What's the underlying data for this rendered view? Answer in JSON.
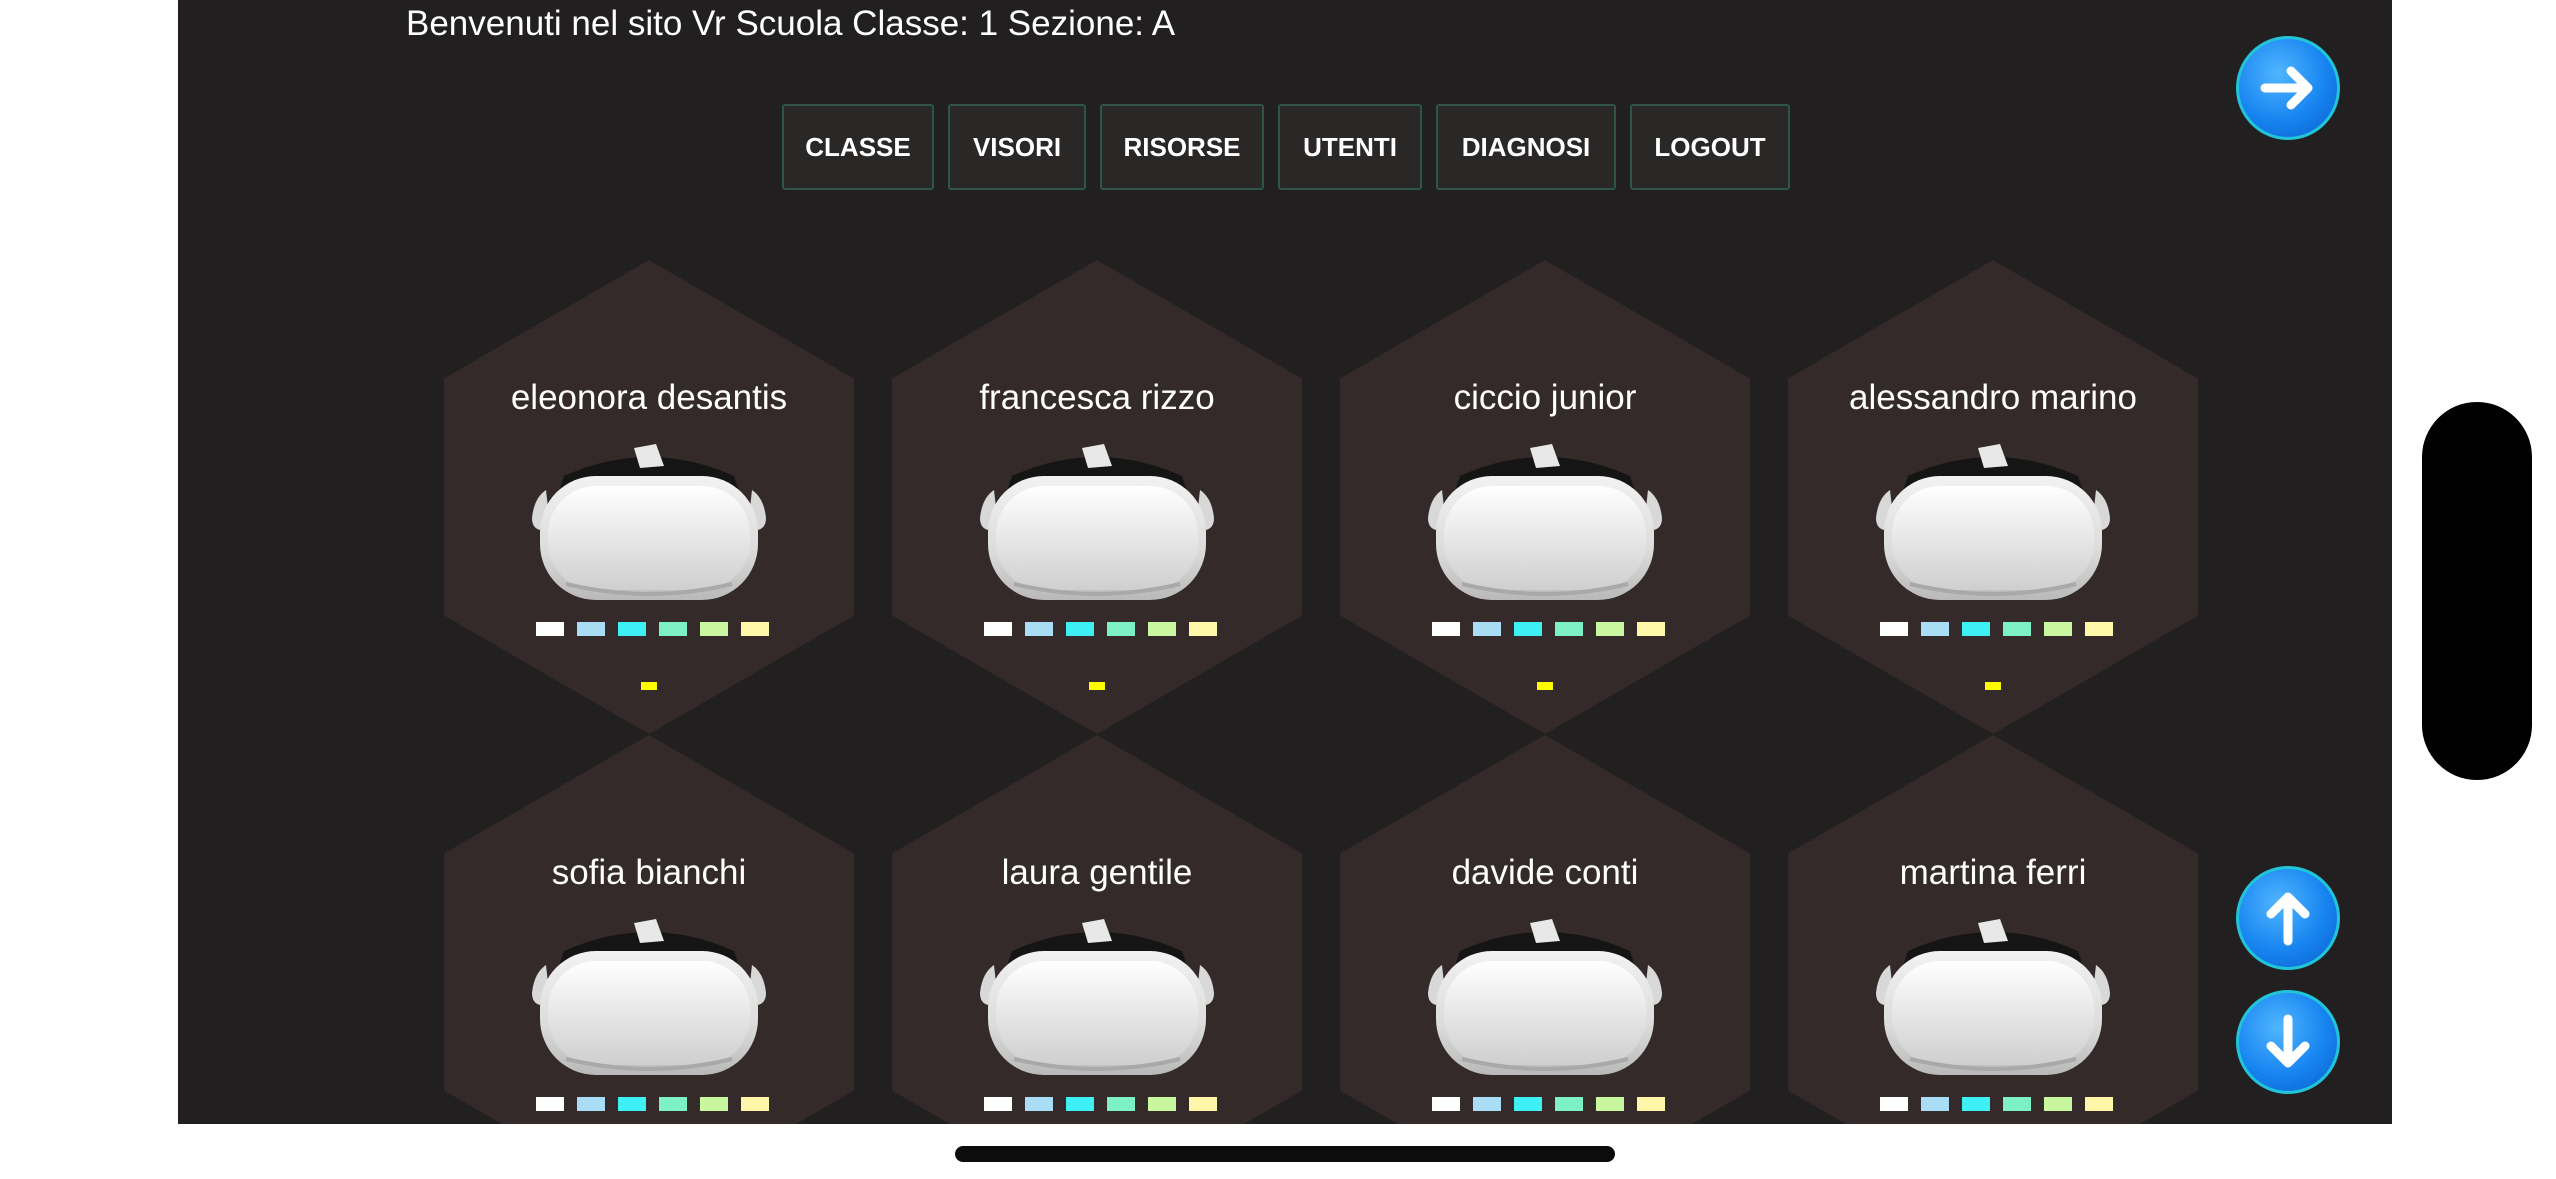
{
  "header": {
    "welcome": "Benvenuti nel sito Vr Scuola Classe: 1 Sezione: A"
  },
  "nav": {
    "items": [
      {
        "label": "CLASSE"
      },
      {
        "label": "VISORI"
      },
      {
        "label": "RISORSE"
      },
      {
        "label": "UTENTI"
      },
      {
        "label": "DIAGNOSI"
      },
      {
        "label": "LOGOUT"
      }
    ]
  },
  "students": [
    {
      "name": "eleonora desantis"
    },
    {
      "name": "francesca rizzo"
    },
    {
      "name": "ciccio junior"
    },
    {
      "name": "alessandro marino"
    },
    {
      "name": "sofia bianchi"
    },
    {
      "name": "laura gentile"
    },
    {
      "name": "davide conti"
    },
    {
      "name": "martina ferri"
    }
  ],
  "status_colors": [
    "#ffffff",
    "#a8ddf5",
    "#3ef0f5",
    "#7ef0c8",
    "#c8f7a0",
    "#fff7a8"
  ],
  "indicator_color": "#fffb00",
  "icons": {
    "next": "arrow-right-icon",
    "scroll_up": "arrow-up-icon",
    "scroll_down": "arrow-down-icon"
  }
}
